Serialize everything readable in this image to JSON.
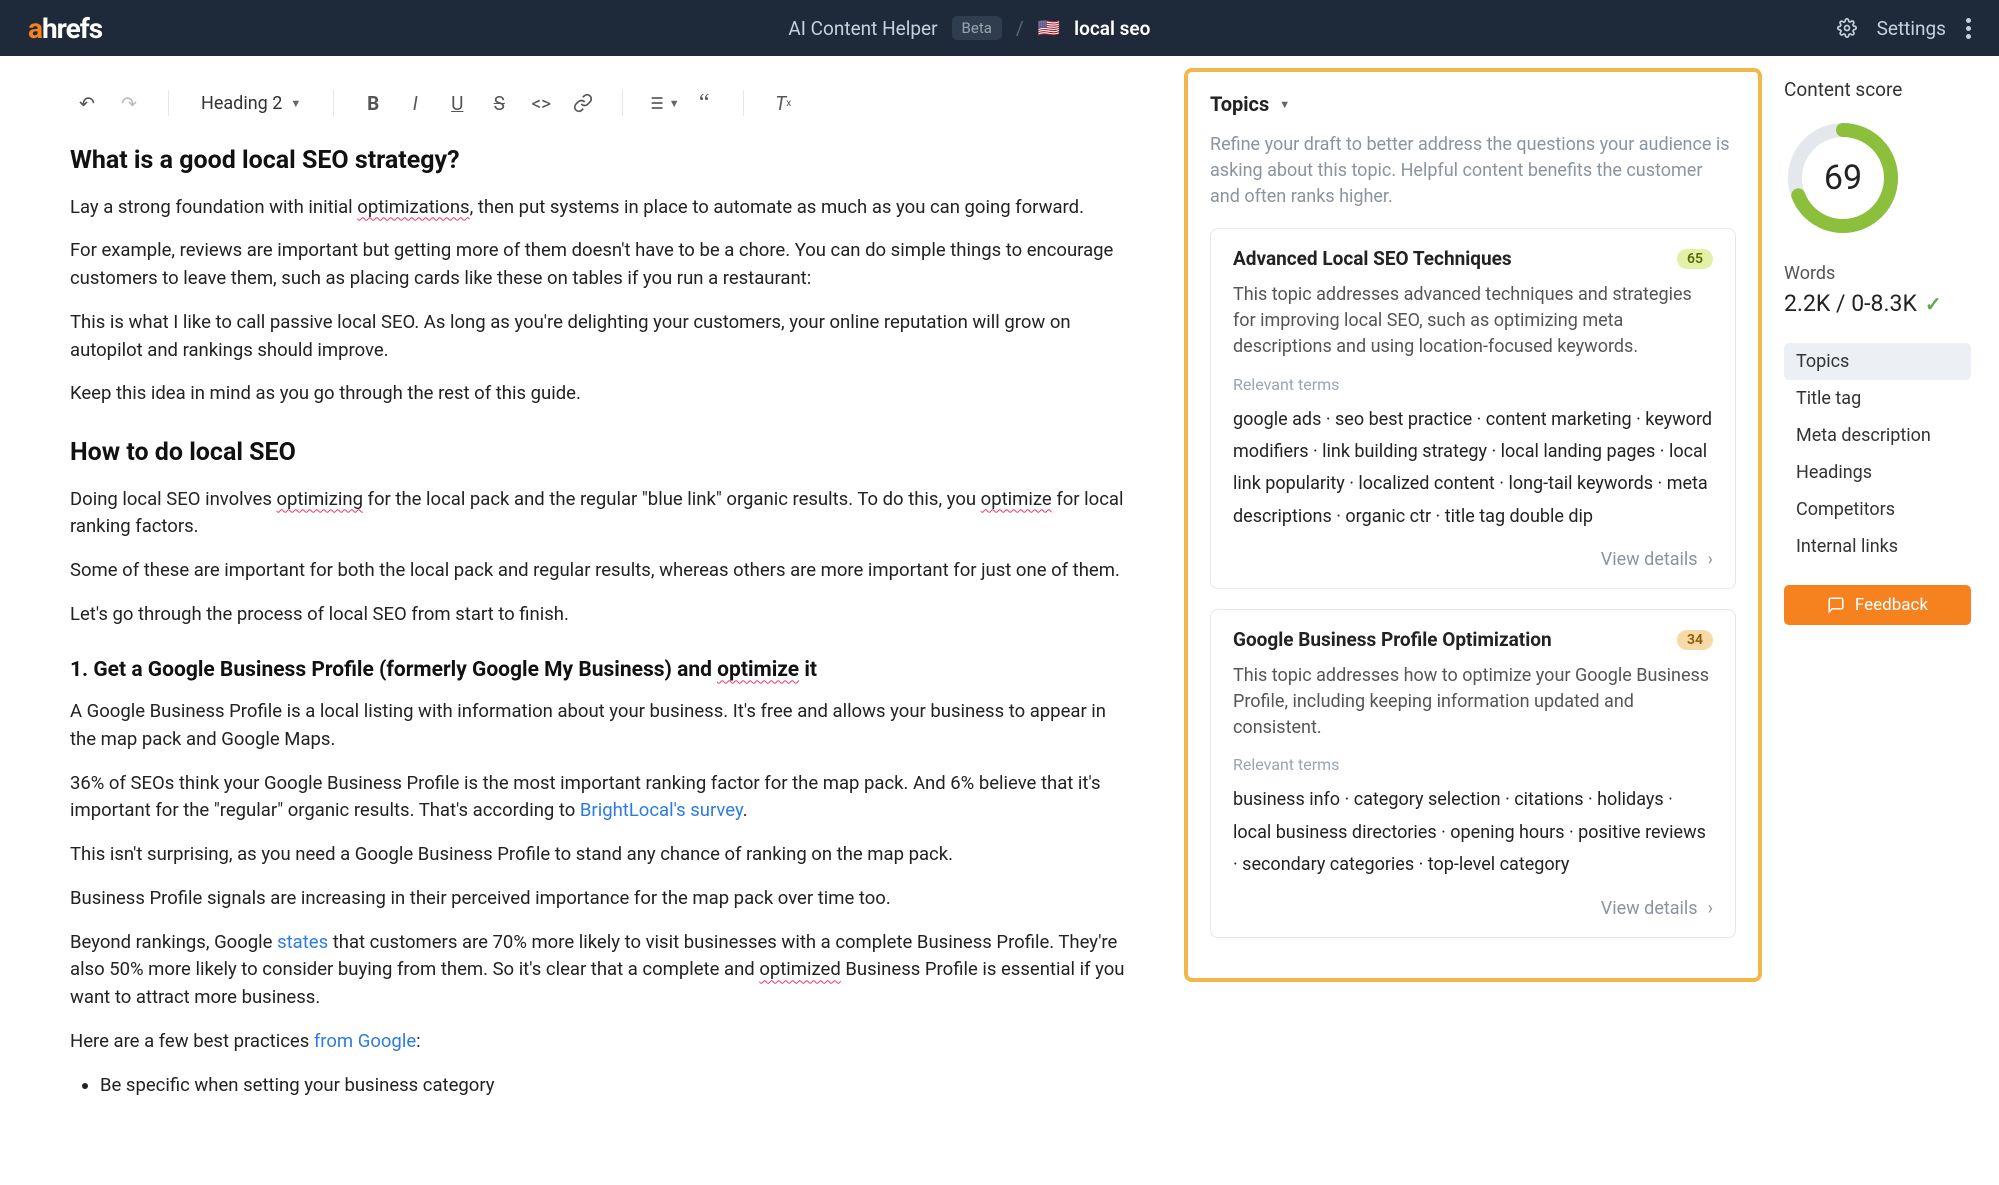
{
  "topbar": {
    "logo_a": "a",
    "logo_rest": "hrefs",
    "breadcrumb_app": "AI Content Helper",
    "beta": "Beta",
    "current": "local seo",
    "settings": "Settings"
  },
  "toolbar": {
    "heading": "Heading 2"
  },
  "content": {
    "h2_1": "What is a good local SEO strategy?",
    "p1_a": "Lay a strong foundation with initial ",
    "p1_u": "optimizations",
    "p1_b": ", then put systems in place to automate as much as you can going forward.",
    "p2": "For example, reviews are important but getting more of them doesn't have to be a chore. You can do simple things to encourage customers to leave them, such as placing cards like these on tables if you run a restaurant:",
    "p3": "This is what I like to call passive local SEO. As long as you're delighting your customers, your online reputation will grow on autopilot and rankings should improve.",
    "p4": "Keep this idea in mind as you go through the rest of this guide.",
    "h2_2": "How to do local SEO",
    "p5_a": "Doing local SEO involves ",
    "p5_u1": "optimizing",
    "p5_b": " for the local pack and the regular \"blue link\" organic results. To do this, you ",
    "p5_u2": "optimize",
    "p5_c": " for local ranking factors.",
    "p6": "Some of these are important for both the local pack and regular results, whereas others are more important for just one of them.",
    "p7": "Let's go through the process of local SEO from start to finish.",
    "h3_1_a": "1. Get a Google Business Profile (formerly Google My Business) and ",
    "h3_1_u": "optimize",
    "h3_1_b": " it",
    "p8": "A Google Business Profile is a local listing with information about your business. It's free and allows your business to appear in the map pack and Google Maps.",
    "p9_a": "36% of SEOs think your Google Business Profile is the most important ranking factor for the map pack. And 6% believe that it's important for the \"regular\" organic results. That's according to ",
    "p9_link": "BrightLocal's survey",
    "p9_b": ".",
    "p10": "This isn't surprising, as you need a Google Business Profile to stand any chance of ranking on the map pack.",
    "p11": "Business Profile signals are increasing in their perceived importance for the map pack over time too.",
    "p12_a": "Beyond rankings, Google ",
    "p12_link1": "states",
    "p12_b": " that customers are 70% more likely to visit businesses with a complete Business Profile. They're also 50% more likely to consider buying from them. So it's clear that a complete and ",
    "p12_u": "optimized",
    "p12_c": " Business Profile is essential if you want to attract more business.",
    "p13_a": "Here are a few best practices ",
    "p13_link": "from Google",
    "p13_b": ":",
    "li1": "Be specific when setting your business category"
  },
  "topics": {
    "header": "Topics",
    "help": "Refine your draft to better address the questions your audience is asking about this topic. Helpful content benefits the customer and often ranks higher.",
    "view_details": "View details",
    "relevant_label": "Relevant terms",
    "cards": [
      {
        "title": "Advanced Local SEO Techniques",
        "score": "65",
        "badge_class": "g",
        "desc": "This topic addresses advanced techniques and strategies for improving local SEO, such as optimizing meta descriptions and using location-focused keywords.",
        "terms": "google ads · seo best practice · content marketing · keyword modifiers · link building strategy · local landing pages · local link popularity · localized content · long-tail keywords · meta descriptions · organic ctr · title tag double dip"
      },
      {
        "title": "Google Business Profile Optimization",
        "score": "34",
        "badge_class": "o",
        "desc": "This topic addresses how to optimize your Google Business Profile, including keeping information updated and consistent.",
        "terms": "business info · category selection · citations · holidays · local business directories · opening hours · positive reviews · secondary categories · top-level category"
      }
    ]
  },
  "score": {
    "label": "Content score",
    "value": "69",
    "words_label": "Words",
    "words_value": "2.2K / 0-8.3K",
    "tabs": [
      "Topics",
      "Title tag",
      "Meta description",
      "Headings",
      "Competitors",
      "Internal links"
    ],
    "feedback": "Feedback"
  }
}
